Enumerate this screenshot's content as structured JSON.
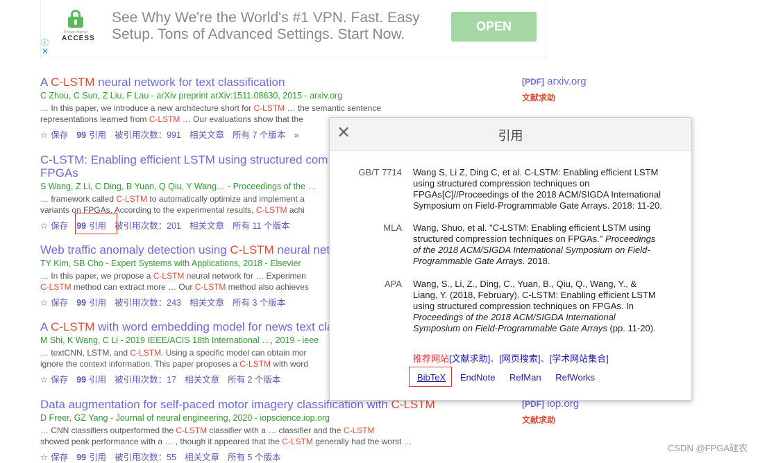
{
  "ad": {
    "brand_small": "Private Internet",
    "brand": "ACCESS",
    "text": "See Why We're the World's #1 VPN. Fast. Easy Setup. Tons of Advanced Settings. Start Now.",
    "button": "OPEN",
    "info_icon": "ⓘ",
    "close_icon": "✕"
  },
  "results": [
    {
      "title_pre": "A ",
      "title_hl": "C-LSTM",
      "title_post": " neural network for text classification",
      "authors": "C Zhou, C Sun, Z Liu, F Lau - arXiv preprint arXiv:1511.08630, 2015 - arxiv.org",
      "snippet1_a": "… In this paper, we introduce a new architecture short for ",
      "snippet1_hl": "C-LSTM",
      "snippet1_b": " … the semantic sentence",
      "snippet2_a": "representations learned from ",
      "snippet2_hl": "C-LSTM",
      "snippet2_b": " … Our evaluations show that the ",
      "save": "保存",
      "cite": "引用",
      "cited_by": "被引用次数：991",
      "related": "相关文章",
      "versions": "所有 7 个版本",
      "more": "»"
    },
    {
      "title_line1": "C-LSTM: Enabling efficient LSTM using structured com",
      "title_line2": "FPGAs",
      "authors": "S Wang, Z Li, C Ding, B Yuan, Q Qiu, Y Wang… - Proceedings of the …",
      "snippet1_a": "… framework called ",
      "snippet1_hl": "C-LSTM",
      "snippet1_b": " to automatically optimize and implement a",
      "snippet2_a": "variants on FPGAs. According to the experimental results, ",
      "snippet2_hl": "C-LSTM",
      "snippet2_b": " achi",
      "save": "保存",
      "cite": "引用",
      "cited_by": "被引用次数：201",
      "related": "相关文章",
      "versions": "所有 11 个版本"
    },
    {
      "title_pre": "Web traffic anomaly detection using ",
      "title_hl": "C-LSTM",
      "title_post": " neural net",
      "authors": "TY Kim, SB Cho - Expert Systems with Applications, 2018 - Elsevier",
      "snippet1_a": "… In this paper, we propose a ",
      "snippet1_hl": "C-LSTM",
      "snippet1_b": " neural network for … Experimen",
      "snippet2_a": "",
      "snippet2_hl": "C-LSTM",
      "snippet2_b": " method can extract more … Our ",
      "snippet2_hl2": "C-LSTM",
      "snippet2_c": " method also achieves",
      "save": "保存",
      "cite": "引用",
      "cited_by": "被引用次数：243",
      "related": "相关文章",
      "versions": "所有 3 个版本"
    },
    {
      "title_pre": "A ",
      "title_hl": "C-LSTM",
      "title_post": " with word embedding model for news text cla",
      "authors": "M Shi, K Wang, C Li - 2019 IEEE/ACIS 18th International …, 2019 - ieee",
      "snippet1_a": "… textCNN, LSTM, and ",
      "snippet1_hl": "C-LSTM",
      "snippet1_b": ". Using a specific model can obtain mor",
      "snippet2_a": "ignore the context information. This paper proposes a ",
      "snippet2_hl": "C-LSTM",
      "snippet2_b": " with word",
      "save": "保存",
      "cite": "引用",
      "cited_by": "被引用次数：17",
      "related": "相关文章",
      "versions": "所有 2 个版本"
    },
    {
      "title_pre": "Data augmentation for self-paced motor imagery classification with ",
      "title_hl": "C-LSTM",
      "title_post": "",
      "authors": "D Freer, GZ Yang - Journal of neural engineering, 2020 - iopscience.iop.org",
      "snippet1_a": "… CNN classifiers outperformed the ",
      "snippet1_hl": "C-LSTM",
      "snippet1_b": " classifier with a … classifier and the ",
      "snippet1_hl2": "C-LSTM",
      "snippet2_a": "showed peak performance with a … , though it appeared that the ",
      "snippet2_hl": "C-LSTM",
      "snippet2_b": " generally had the worst …",
      "save": "保存",
      "cite": "引用",
      "cited_by": "被引用次数：55",
      "related": "相关文章",
      "versions": "所有 5 个版本"
    }
  ],
  "side": [
    {
      "tag": "[PDF]",
      "site": "arxiv.org",
      "request": "文献求助"
    },
    {
      "tag": "[PDF]",
      "site": "iop.org",
      "request": "文献求助"
    }
  ],
  "modal": {
    "title": "引用",
    "close_icon": "✕",
    "gbt_label": "GB/T 7714",
    "gbt_text": "Wang S, Li Z, Ding C, et al. C-LSTM: Enabling efficient LSTM using structured compression techniques on FPGAs[C]//Proceedings of the 2018 ACM/SIGDA International Symposium on Field-Programmable Gate Arrays. 2018: 11-20.",
    "mla_label": "MLA",
    "mla_pre": "Wang, Shuo, et al. \"C-LSTM: Enabling efficient LSTM using structured compression techniques on FPGAs.\" ",
    "mla_ital": "Proceedings of the 2018 ACM/SIGDA International Symposium on Field-Programmable Gate Arrays",
    "mla_post": ". 2018.",
    "apa_label": "APA",
    "apa_pre": "Wang, S., Li, Z., Ding, C., Yuan, B., Qiu, Q., Wang, Y., & Liang, Y. (2018, February). C-LSTM: Enabling efficient LSTM using structured compression techniques on FPGAs. In ",
    "apa_ital": "Proceedings of the 2018 ACM/SIGDA International Symposium on Field-Programmable Gate Arrays",
    "apa_post": " (pp. 11-20).",
    "links_prefix": "推荐网站",
    "link1": "[文献求助]",
    "link2": "[网页搜索]",
    "link3": "[学术网站集合]",
    "sep": "、",
    "export_bibtex": "BibTeX",
    "export_endnote": "EndNote",
    "export_refman": "RefMan",
    "export_refworks": "RefWorks"
  },
  "watermark": "CSDN @FPGA硅农",
  "icons": {
    "star": "☆",
    "quote": "99"
  }
}
